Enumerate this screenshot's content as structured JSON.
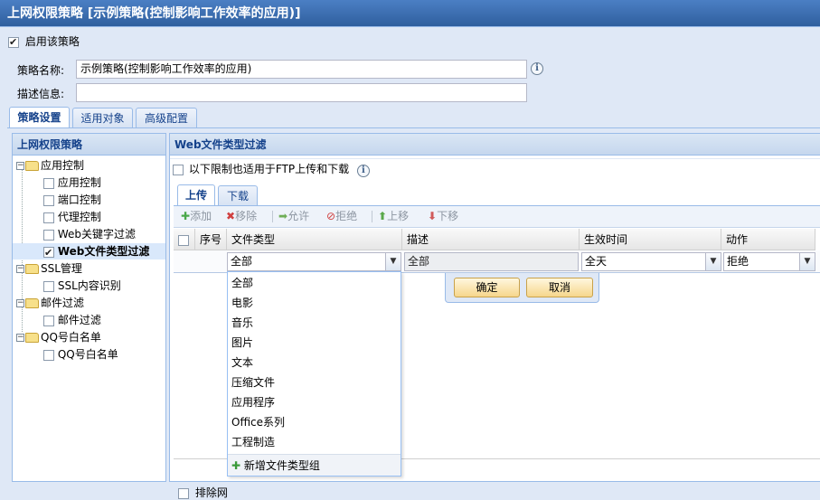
{
  "window": {
    "title": "上网权限策略 [示例策略(控制影响工作效率的应用)]"
  },
  "enable_policy": {
    "label": "启用该策略",
    "checked": true
  },
  "policy_name": {
    "label": "策略名称:",
    "value": "示例策略(控制影响工作效率的应用)"
  },
  "description": {
    "label": "描述信息:",
    "value": ""
  },
  "main_tabs": [
    {
      "label": "策略设置",
      "active": true
    },
    {
      "label": "适用对象",
      "active": false
    },
    {
      "label": "高级配置",
      "active": false
    }
  ],
  "left_panel": {
    "title": "上网权限策略",
    "tree": [
      {
        "label": "应用控制",
        "type": "group"
      },
      {
        "label": "应用控制",
        "type": "leaf",
        "checked": false
      },
      {
        "label": "端口控制",
        "type": "leaf",
        "checked": false
      },
      {
        "label": "代理控制",
        "type": "leaf",
        "checked": false
      },
      {
        "label": "Web关键字过滤",
        "type": "leaf",
        "checked": false
      },
      {
        "label": "Web文件类型过滤",
        "type": "leaf",
        "checked": true,
        "selected": true
      },
      {
        "label": "SSL管理",
        "type": "group"
      },
      {
        "label": "SSL内容识别",
        "type": "leaf",
        "checked": false
      },
      {
        "label": "邮件过滤",
        "type": "group"
      },
      {
        "label": "邮件过滤",
        "type": "leaf",
        "checked": false
      },
      {
        "label": "QQ号白名单",
        "type": "group"
      },
      {
        "label": "QQ号白名单",
        "type": "leaf",
        "checked": false
      }
    ]
  },
  "right_panel": {
    "title": "Web文件类型过滤",
    "ftp_option": {
      "label": "以下限制也适用于FTP上传和下载",
      "checked": false
    },
    "sub_tabs": [
      {
        "label": "上传",
        "active": true
      },
      {
        "label": "下载",
        "active": false
      }
    ],
    "toolbar": {
      "add": "添加",
      "remove": "移除",
      "allow": "允许",
      "deny": "拒绝",
      "up": "上移",
      "down": "下移"
    },
    "grid": {
      "columns": [
        "序号",
        "文件类型",
        "描述",
        "生效时间",
        "动作"
      ],
      "edit_row": {
        "file_type": "全部",
        "description": "全部",
        "effective_time": "全天",
        "action": "拒绝"
      }
    },
    "editor_buttons": {
      "ok": "确定",
      "cancel": "取消"
    },
    "bottom_option": {
      "label": "排除网",
      "checked": false
    }
  },
  "dropdown": {
    "options": [
      "全部",
      "电影",
      "音乐",
      "图片",
      "文本",
      "压缩文件",
      "应用程序",
      "Office系列",
      "工程制造"
    ],
    "add_group": "新增文件类型组"
  },
  "colors": {
    "title_bg": "#2f5f9e",
    "panel_header_text": "#15428b",
    "add_icon": "#3a9a3a"
  }
}
